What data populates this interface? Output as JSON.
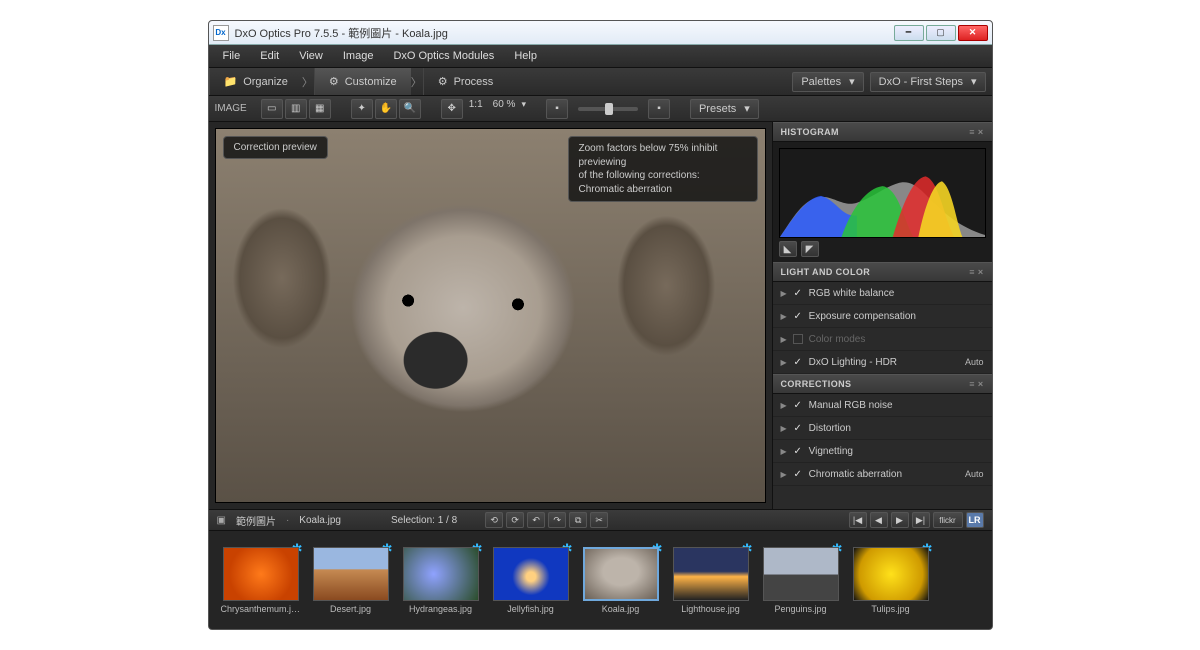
{
  "title": "DxO Optics Pro 7.5.5 - 範例圖片 - Koala.jpg",
  "menu": {
    "file": "File",
    "edit": "Edit",
    "view": "View",
    "image": "Image",
    "modules": "DxO Optics Modules",
    "help": "Help"
  },
  "workflow": {
    "organize": "Organize",
    "customize": "Customize",
    "process": "Process"
  },
  "palettes": {
    "label": "Palettes",
    "workspace": "DxO - First Steps"
  },
  "toolbar": {
    "image": "IMAGE",
    "zoom_ratio": "1:1",
    "zoom_pct": "60 %",
    "presets": "Presets"
  },
  "overlay": {
    "correction": "Correction preview",
    "zoom_note_l1": "Zoom factors below 75% inhibit previewing",
    "zoom_note_l2": "of the following corrections:",
    "zoom_note_l3": "Chromatic aberration"
  },
  "panels": {
    "histogram": "HISTOGRAM",
    "light": "LIGHT AND COLOR",
    "light_items": {
      "wb": "RGB white balance",
      "exp": "Exposure compensation",
      "modes": "Color modes",
      "hdr": "DxO Lighting - HDR",
      "hdr_auto": "Auto"
    },
    "corrections": "CORRECTIONS",
    "corr_items": {
      "noise": "Manual RGB noise",
      "dist": "Distortion",
      "vig": "Vignetting",
      "ca": "Chromatic aberration",
      "ca_auto": "Auto"
    }
  },
  "strip": {
    "folder": "範例圖片",
    "file": "Koala.jpg",
    "selection": "Selection: 1 / 8",
    "flickr": "flickr",
    "lr": "LR"
  },
  "thumbs": [
    {
      "name": "Chrysanthemum.jpg"
    },
    {
      "name": "Desert.jpg"
    },
    {
      "name": "Hydrangeas.jpg"
    },
    {
      "name": "Jellyfish.jpg"
    },
    {
      "name": "Koala.jpg"
    },
    {
      "name": "Lighthouse.jpg"
    },
    {
      "name": "Penguins.jpg"
    },
    {
      "name": "Tulips.jpg"
    }
  ],
  "thumb_colors": [
    "radial-gradient(circle,#ff7a1a,#c94200 70%)",
    "linear-gradient(#9ab7e0 40%,#c58a52 42%,#8a4a20)",
    "radial-gradient(circle at 40% 50%,#8fa2ff,#2b4d2b)",
    "radial-gradient(circle at 50% 55%,#ffd080 10%,#1038c0 40%)",
    "radial-gradient(ellipse at 50% 45%,#bdb4aa 35%,#6a6056)",
    "linear-gradient(#2a3560 45%,#ffb347 55%,#222)",
    "linear-gradient(#aeb8c8 50%,#444 52%)",
    "radial-gradient(circle,#ffe11a,#cf9a00 70%,#111)"
  ]
}
